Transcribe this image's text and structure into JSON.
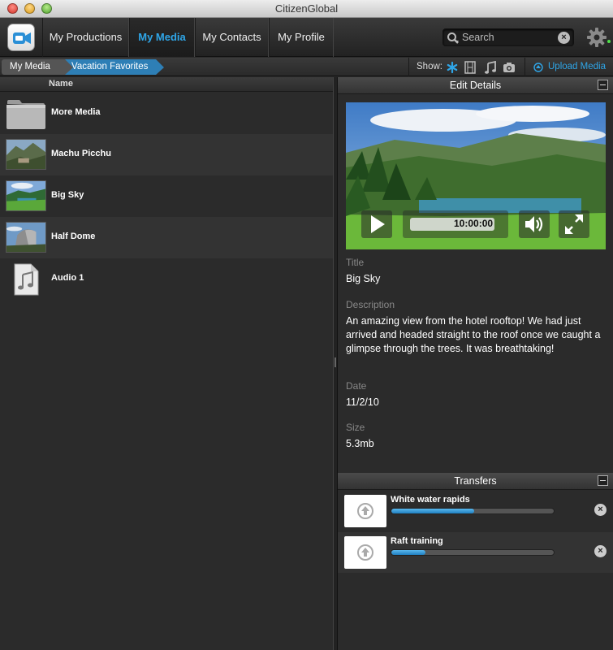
{
  "window": {
    "title": "CitizenGlobal"
  },
  "nav": {
    "tabs": [
      {
        "label": "My Productions"
      },
      {
        "label": "My Media",
        "active": true
      },
      {
        "label": "My Contacts"
      },
      {
        "label": "My Profile"
      }
    ]
  },
  "search": {
    "placeholder": "Search"
  },
  "breadcrumb": {
    "items": [
      "My Media",
      "Vacation Favorites"
    ]
  },
  "show": {
    "label": "Show:",
    "icons": [
      "star-icon",
      "film-icon",
      "music-note-icon",
      "camera-icon"
    ]
  },
  "upload": {
    "label": "Upload Media"
  },
  "media_list": {
    "column_header": "Name",
    "items": [
      {
        "name": "More Media",
        "icon": "folder-icon"
      },
      {
        "name": "Machu Picchu",
        "icon": "photo-thumbnail"
      },
      {
        "name": "Big Sky",
        "icon": "photo-thumbnail"
      },
      {
        "name": "Half Dome",
        "icon": "photo-thumbnail"
      },
      {
        "name": "Audio 1",
        "icon": "audio-file-icon"
      }
    ]
  },
  "edit_details": {
    "header": "Edit Details",
    "player": {
      "time": "10:00:00"
    },
    "fields": {
      "title_label": "Title",
      "title_value": "Big Sky",
      "description_label": "Description",
      "description_value": "An amazing view from the hotel rooftop!  We had just arrived and headed straight to the roof once we caught a glimpse through the trees.  It was breathtaking!",
      "date_label": "Date",
      "date_value": "11/2/10",
      "size_label": "Size",
      "size_value": "5.3mb"
    }
  },
  "transfers": {
    "header": "Transfers",
    "items": [
      {
        "name": "White water rapids",
        "progress": 0.51
      },
      {
        "name": "Raft training",
        "progress": 0.21
      }
    ]
  },
  "colors": {
    "accent": "#2fa6e8",
    "crumb_active": "#2e7fb6"
  }
}
